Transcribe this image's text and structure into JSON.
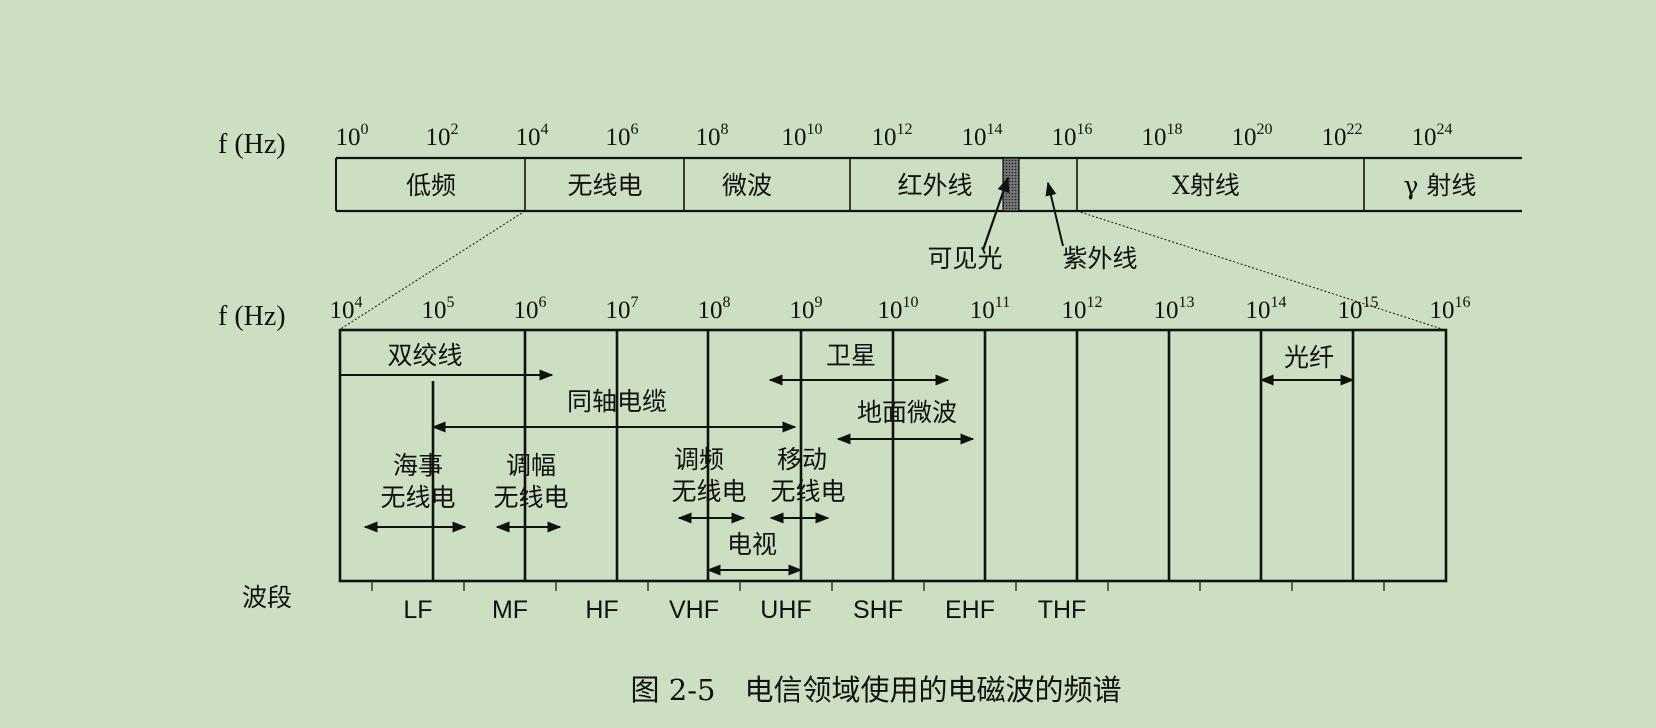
{
  "top_axis": {
    "label": "f (Hz)",
    "ticks": [
      {
        "base": "10",
        "exp": "0"
      },
      {
        "base": "10",
        "exp": "2"
      },
      {
        "base": "10",
        "exp": "4"
      },
      {
        "base": "10",
        "exp": "6"
      },
      {
        "base": "10",
        "exp": "8"
      },
      {
        "base": "10",
        "exp": "10"
      },
      {
        "base": "10",
        "exp": "12"
      },
      {
        "base": "10",
        "exp": "14"
      },
      {
        "base": "10",
        "exp": "16"
      },
      {
        "base": "10",
        "exp": "18"
      },
      {
        "base": "10",
        "exp": "20"
      },
      {
        "base": "10",
        "exp": "22"
      },
      {
        "base": "10",
        "exp": "24"
      }
    ]
  },
  "top_bands": [
    "低频",
    "无线电",
    "微波",
    "红外线",
    "X射线",
    "γ 射线"
  ],
  "top_callouts": {
    "visible": "可见光",
    "ultraviolet": "紫外线"
  },
  "bottom_axis": {
    "label": "f (Hz)",
    "ticks": [
      {
        "base": "10",
        "exp": "4"
      },
      {
        "base": "10",
        "exp": "5"
      },
      {
        "base": "10",
        "exp": "6"
      },
      {
        "base": "10",
        "exp": "7"
      },
      {
        "base": "10",
        "exp": "8"
      },
      {
        "base": "10",
        "exp": "9"
      },
      {
        "base": "10",
        "exp": "10"
      },
      {
        "base": "10",
        "exp": "11"
      },
      {
        "base": "10",
        "exp": "12"
      },
      {
        "base": "10",
        "exp": "13"
      },
      {
        "base": "10",
        "exp": "14"
      },
      {
        "base": "10",
        "exp": "15"
      },
      {
        "base": "10",
        "exp": "16"
      }
    ]
  },
  "media": {
    "twisted_pair": "双绞线",
    "coax": "同轴电缆",
    "satellite": "卫星",
    "terrestrial_microwave": "地面微波",
    "fiber": "光纤",
    "maritime_1": "海事",
    "maritime_2": "无线电",
    "am_1": "调幅",
    "am_2": "无线电",
    "fm_1": "调频",
    "fm_2": "无线电",
    "mobile_1": "移动",
    "mobile_2": "无线电",
    "tv": "电视"
  },
  "band_row": {
    "label": "波段",
    "names": [
      "LF",
      "MF",
      "HF",
      "VHF",
      "UHF",
      "SHF",
      "EHF",
      "THF"
    ]
  },
  "caption": "图 2-5　电信领域使用的电磁波的频谱"
}
